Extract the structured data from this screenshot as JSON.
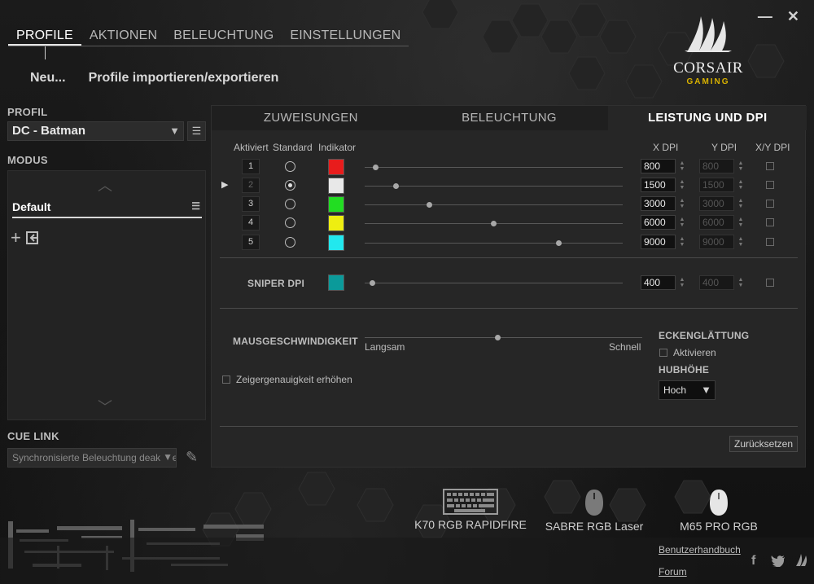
{
  "nav": {
    "tabs": [
      "PROFILE",
      "AKTIONEN",
      "BELEUCHTUNG",
      "EINSTELLUNGEN"
    ],
    "active": 0
  },
  "subactions": {
    "new": "Neu...",
    "import_export": "Profile importieren/exportieren"
  },
  "window": {
    "minimize": "—",
    "close": "✕"
  },
  "logo": {
    "brand": "CORSAIR",
    "sub": "GAMING"
  },
  "left": {
    "profile_label": "PROFIL",
    "profile_value": "DC - Batman",
    "modus_label": "MODUS",
    "mode_name": "Default",
    "cue_label": "CUE LINK",
    "cue_value": "Synchronisierte Beleuchtung deaktivieren"
  },
  "panel": {
    "tabs": [
      "ZUWEISUNGEN",
      "BELEUCHTUNG",
      "LEISTUNG UND DPI"
    ],
    "active": 2,
    "headers": {
      "enabled": "Aktiviert",
      "standard": "Standard",
      "indicator": "Indikator",
      "xdpi": "X DPI",
      "ydpi": "Y DPI",
      "xydpi": "X/Y DPI"
    },
    "dpi_rows": [
      {
        "num": "1",
        "color": "#e81c1c",
        "xdpi": "800",
        "ydpi": "800",
        "level": 0.03,
        "selected": false,
        "current": false
      },
      {
        "num": "2",
        "color": "#e8e8e8",
        "xdpi": "1500",
        "ydpi": "1500",
        "level": 0.11,
        "selected": true,
        "current": true
      },
      {
        "num": "3",
        "color": "#22dd22",
        "xdpi": "3000",
        "ydpi": "3000",
        "level": 0.24,
        "selected": false,
        "current": false
      },
      {
        "num": "4",
        "color": "#eeee11",
        "xdpi": "6000",
        "ydpi": "6000",
        "level": 0.49,
        "selected": false,
        "current": false
      },
      {
        "num": "5",
        "color": "#22e8ee",
        "xdpi": "9000",
        "ydpi": "9000",
        "level": 0.74,
        "selected": false,
        "current": false
      }
    ],
    "sniper": {
      "label": "SNIPER DPI",
      "color": "#0b9a9a",
      "xdpi": "400",
      "ydpi": "400",
      "level": 0.02
    },
    "speed": {
      "label": "MAUSGESCHWINDIGKEIT",
      "slow": "Langsam",
      "fast": "Schnell",
      "level": 0.47
    },
    "pointer_precision": "Zeigergenauigkeit erhöhen",
    "angle_snapping": {
      "label": "ECKENGLÄTTUNG",
      "checkbox": "Aktivieren"
    },
    "lift_height": {
      "label": "HUBHÖHE",
      "value": "Hoch"
    },
    "reset": "Zurücksetzen"
  },
  "devices": [
    {
      "name": "K70 RGB RAPIDFIRE",
      "icon": "keyboard-icon"
    },
    {
      "name": "SABRE RGB Laser",
      "icon": "mouse-icon"
    },
    {
      "name": "M65 PRO RGB",
      "icon": "mouse-icon"
    }
  ],
  "footer": {
    "manual": "Benutzerhandbuch",
    "forum": "Forum",
    "social": [
      "facebook-icon",
      "twitter-icon",
      "corsair-icon"
    ]
  }
}
